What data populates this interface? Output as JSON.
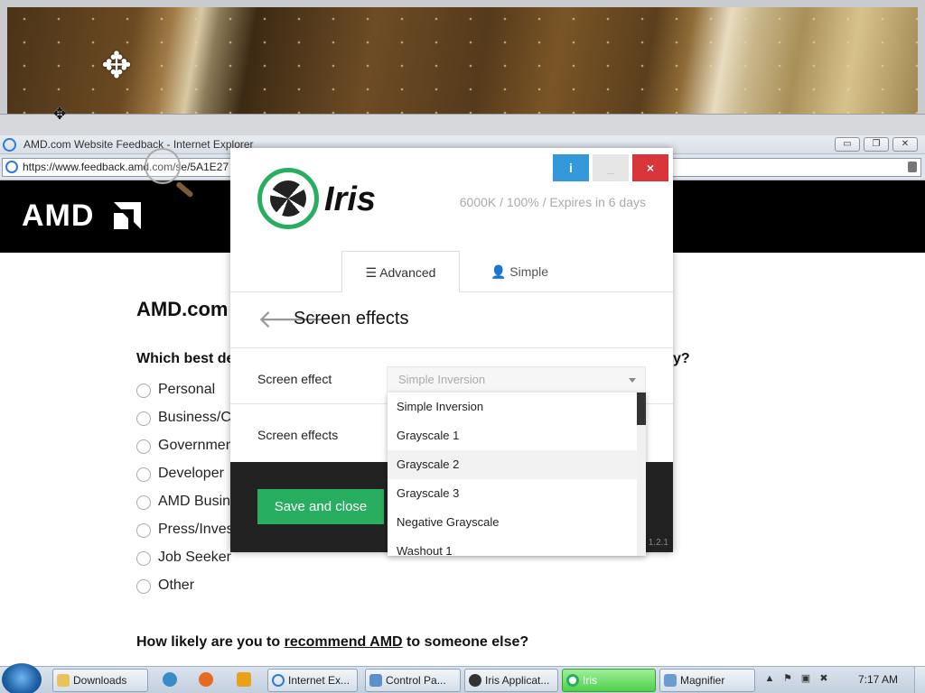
{
  "ie": {
    "window_title": "AMD.com Website Feedback - Internet Explorer",
    "url": "https://www.feedback.amd.com/se/5A1E27"
  },
  "amd": {
    "logo_text": "AMD",
    "page_title": "AMD.com",
    "question1_start": "Which best de",
    "question1_end": "y?",
    "options": [
      "Personal",
      "Business/C",
      "Governmen",
      "Developer",
      "AMD Busin",
      "Press/Inves",
      "Job Seeker",
      "Other"
    ],
    "question2_prefix": "How likely are you to ",
    "question2_link": "recommend AMD",
    "question2_suffix": " to someone else?"
  },
  "iris": {
    "app_name": "Iris",
    "status": "6000K / 100% / Expires in 6 days",
    "buttons": {
      "info": "i",
      "min": "_",
      "close": "×"
    },
    "tabs": {
      "advanced": "Advanced",
      "simple": "Simple"
    },
    "section_title": "Screen effects",
    "row1_label": "Screen effect",
    "row1_value": "Simple Inversion",
    "row2_label": "Screen effects",
    "save_label": "Save and close",
    "version": "1.2.1",
    "dropdown_items": [
      "Simple Inversion",
      "Grayscale 1",
      "Grayscale 2",
      "Grayscale 3",
      "Negative Grayscale",
      "Washout 1"
    ],
    "dropdown_hovered": "Grayscale 2"
  },
  "taskbar": {
    "items": [
      "Downloads",
      "Internet Ex...",
      "Control Pa...",
      "Iris Applicat...",
      "Iris",
      "Magnifier"
    ],
    "active_item": "Iris",
    "clock": "7:17 AM"
  },
  "colors": {
    "iris_green": "#27ae60",
    "info_blue": "#3498db",
    "close_red": "#d9353a"
  }
}
